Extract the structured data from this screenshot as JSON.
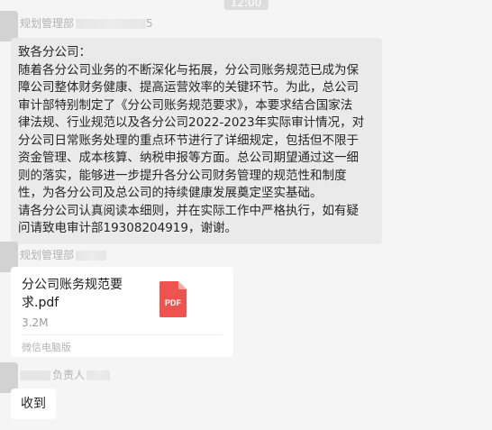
{
  "time_badge": "12:00",
  "messages": [
    {
      "sender": "规划管理部",
      "sender_suffix": "5",
      "lines": [
        "致各分公司：",
        "随着各分公司业务的不断深化与拓展，分公司账务规范已成为保",
        "障公司整体财务健康、提高运营效率的关键环节。为此，总公司",
        "审计部特别制定了《分公司账务规范要求》，本要求结合国家法",
        "律法规、行业规范以及各分公司2022-2023年实际审计情况，对",
        "分公司日常账务处理的重点环节进行了详细规定，包括但不限于",
        "资金管理、成本核算、纳税申报等方面。总公司期望通过这一细",
        "则的落实，能够进一步提升各分公司财务管理的规范性和制度",
        "性，为各分公司及总公司的持续健康发展奠定坚实基础。",
        "请各分公司认真阅读本细则，并在实际工作中严格执行，如有疑",
        "问请致电审计部19308204919，谢谢。"
      ]
    },
    {
      "sender": "规划管理部",
      "file": {
        "name": "分公司账务规范要求.pdf",
        "size": "3.2M",
        "icon_label": "PDF",
        "source": "微信电脑版"
      }
    },
    {
      "sender": "负责人",
      "text": "收到"
    }
  ]
}
